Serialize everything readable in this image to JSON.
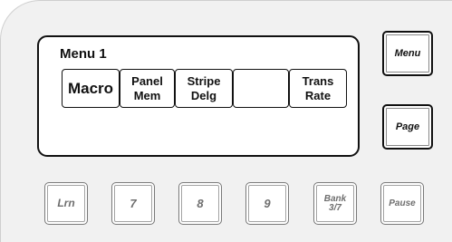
{
  "display": {
    "menu_title": "Menu 1",
    "softkeys": [
      {
        "lines": [
          "Macro"
        ]
      },
      {
        "lines": [
          "Panel",
          "Mem"
        ]
      },
      {
        "lines": [
          "Stripe",
          "Delg"
        ]
      },
      {
        "lines": []
      },
      {
        "lines": [
          "Trans",
          "Rate"
        ]
      }
    ]
  },
  "side_buttons": {
    "menu_label": "Menu",
    "page_label": "Page"
  },
  "keypad": [
    {
      "lines": [
        "Lrn"
      ]
    },
    {
      "lines": [
        "7"
      ]
    },
    {
      "lines": [
        "8"
      ]
    },
    {
      "lines": [
        "9"
      ]
    },
    {
      "lines": [
        "Bank",
        "3/7"
      ]
    },
    {
      "lines": [
        "Pause"
      ]
    }
  ]
}
